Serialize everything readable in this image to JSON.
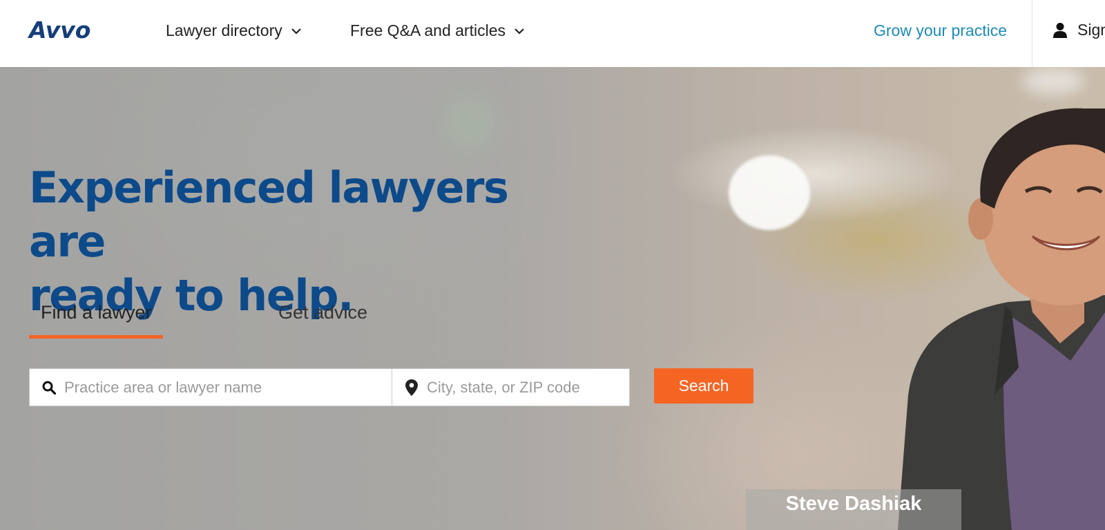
{
  "header": {
    "logo": "Avvo",
    "nav": [
      {
        "label": "Lawyer directory",
        "icon": "chevron-down-icon"
      },
      {
        "label": "Free Q&A and articles",
        "icon": "chevron-down-icon"
      }
    ],
    "grow_link": "Grow your practice",
    "signin_label": "Sign",
    "colors": {
      "brand": "#153e7a",
      "link": "#1b8cb8"
    }
  },
  "hero": {
    "headline_line1": "Experienced lawyers are",
    "headline_line2": "ready to help.",
    "tabs": [
      {
        "label": "Find a lawyer",
        "active": true
      },
      {
        "label": "Get advice",
        "active": false
      }
    ],
    "search": {
      "practice_placeholder": "Practice area or lawyer name",
      "location_placeholder": "City, state, or ZIP code",
      "button_label": "Search"
    },
    "caption": "Steve Dashiak",
    "colors": {
      "headline": "#0d4a8a",
      "accent": "#f46524"
    }
  }
}
